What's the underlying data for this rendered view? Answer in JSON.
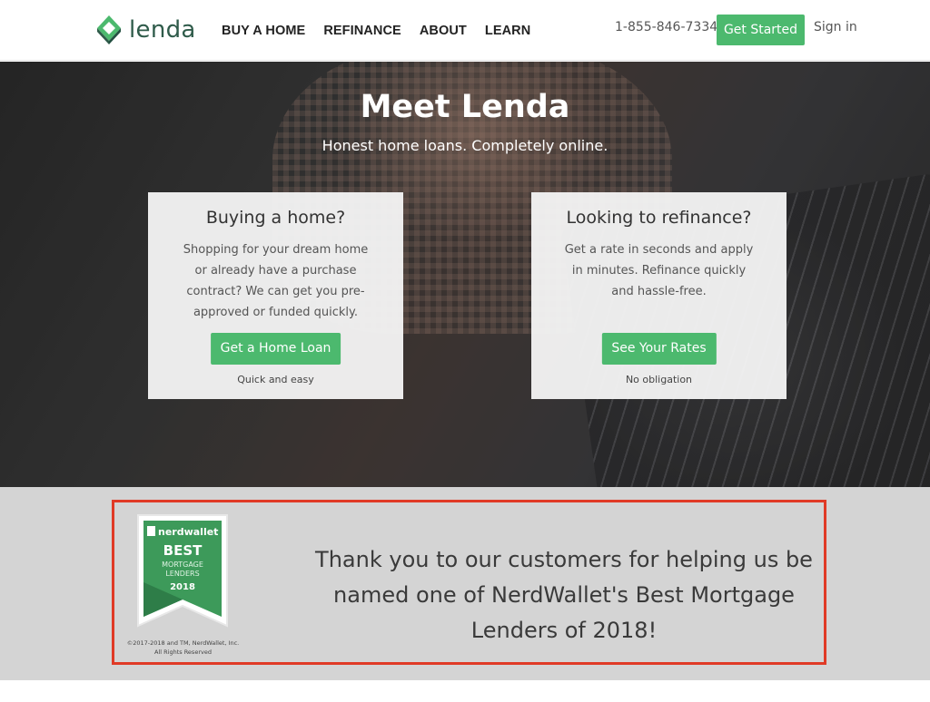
{
  "header": {
    "logo_text": "lenda",
    "logo_icon": "lenda-diamond-logo",
    "nav": [
      "BUY A HOME",
      "REFINANCE",
      "ABOUT",
      "LEARN"
    ],
    "phone": "1-855-846-7334",
    "cta_label": "Get Started",
    "signin_label": "Sign in"
  },
  "hero": {
    "title": "Meet Lenda",
    "subtitle": "Honest home loans. Completely online.",
    "cards": [
      {
        "heading": "Buying a home?",
        "body": "Shopping for your dream home or already have a purchase contract? We can get you pre-approved or funded quickly.",
        "button": "Get a Home Loan",
        "note": "Quick and easy"
      },
      {
        "heading": "Looking to refinance?",
        "body": "Get a rate in seconds and apply in minutes. Refinance quickly and hassle-free.",
        "button": "See Your Rates",
        "note": "No obligation"
      }
    ]
  },
  "award": {
    "badge": {
      "brand": "nerdwallet",
      "line1": "BEST",
      "line2": "MORTGAGE",
      "line3": "LENDERS",
      "year": "2018"
    },
    "copyright_line1": "©2017-2018 and TM, NerdWallet, Inc.",
    "copyright_line2": "All Rights Reserved",
    "message": "Thank you to our customers for helping us be named one of NerdWallet's Best Mortgage Lenders of 2018!"
  },
  "colors": {
    "accent_green": "#4cb96e",
    "logo_green": "#2f5b4a",
    "highlight_red": "#e03a26",
    "band_gray": "#d4d4d4"
  }
}
